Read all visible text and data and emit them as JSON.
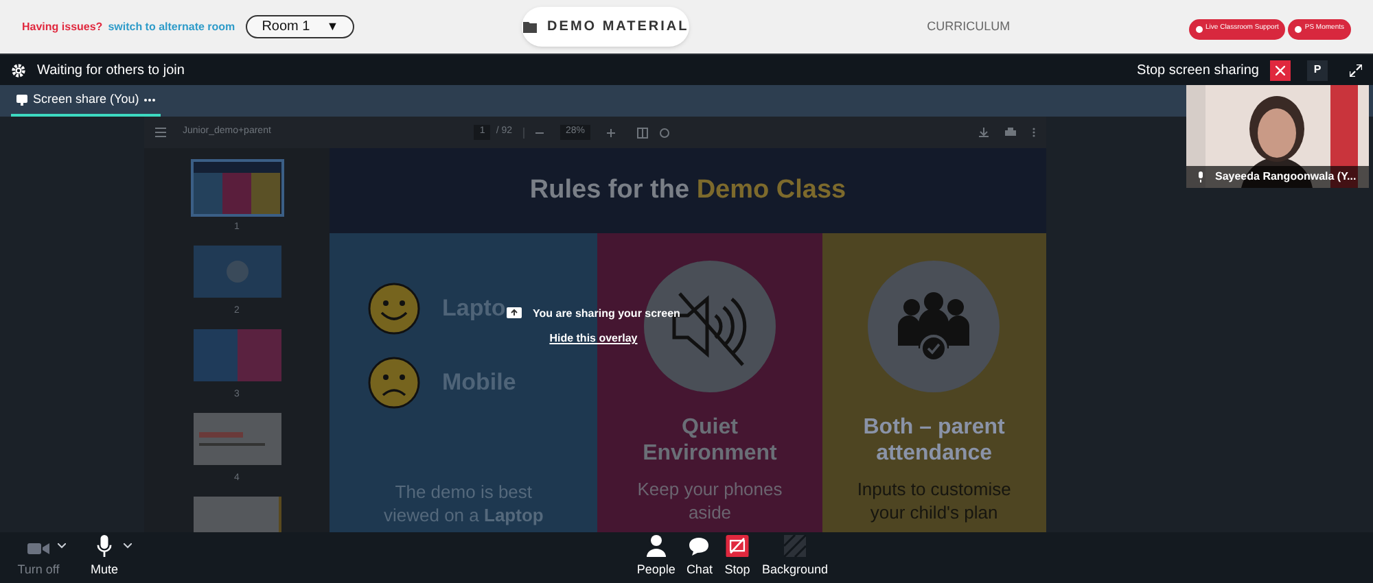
{
  "top_bar": {
    "issue_text": "Having issues?",
    "switch_link": "switch to alternate room",
    "room_select": {
      "value": "Room 1",
      "caret": "▼"
    },
    "demo_button": "DEMO MATERIAL",
    "curriculum": "CURRICULUM",
    "pills": [
      "Live Classroom Support",
      "PS Moments"
    ]
  },
  "meeting_header": {
    "status": "Waiting for others to join",
    "stop_label": "Stop screen sharing",
    "avatar_letter": "P"
  },
  "tabs": [
    {
      "label": "Screen share (You)",
      "selected": true
    }
  ],
  "participant": {
    "name": "Sayeeda Rangoonwala (Y..."
  },
  "pdf_viewer": {
    "file_name": "Junior_demo+parent",
    "page": "1",
    "page_total": "/ 92",
    "zoom": "28%",
    "thumbnails": [
      {
        "label": "1",
        "selected": true
      },
      {
        "label": "2",
        "selected": false
      },
      {
        "label": "3",
        "selected": false
      },
      {
        "label": "4",
        "selected": false
      },
      {
        "selected": false
      }
    ],
    "slide": {
      "title_start": "Rules for the",
      "title_highlight": "Demo Class",
      "columns": [
        {
          "kind": "devices",
          "options": [
            "Lapto",
            "Mobile"
          ],
          "caption": "The demo is best viewed on a **Laptop**"
        },
        {
          "kind": "quiet",
          "heading": "Quiet Environment",
          "caption": "Keep your phones aside"
        },
        {
          "kind": "parent",
          "heading": "Both – parent attendance",
          "caption": "Inputs to customise your child's plan"
        }
      ]
    }
  },
  "overlay": {
    "message": "You are sharing your screen",
    "hide_link": "Hide this overlay"
  },
  "toolbar": [
    {
      "kind": "camera",
      "label": "Turn off",
      "disabled": true,
      "menu": true
    },
    {
      "kind": "mic",
      "label": "Mute",
      "disabled": false,
      "menu": true
    },
    {
      "kind": "people",
      "label": "People",
      "disabled": false,
      "menu": false
    },
    {
      "kind": "chat",
      "label": "Chat",
      "disabled": false,
      "menu": false
    },
    {
      "kind": "stop",
      "label": "Stop",
      "disabled": false,
      "menu": false
    },
    {
      "kind": "background",
      "label": "Background",
      "disabled": false,
      "menu": false
    }
  ]
}
